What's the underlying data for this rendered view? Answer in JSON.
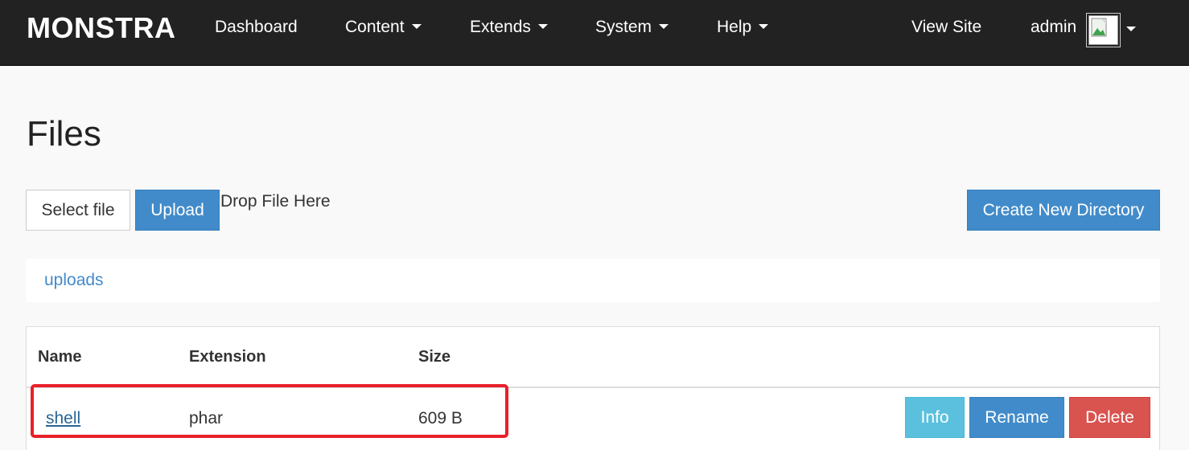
{
  "navbar": {
    "brand": "MONSTRA",
    "items": [
      {
        "label": "Dashboard"
      },
      {
        "label": "Content"
      },
      {
        "label": "Extends"
      },
      {
        "label": "System"
      },
      {
        "label": "Help"
      }
    ],
    "view_site": "View Site",
    "user": "admin"
  },
  "page": {
    "title": "Files"
  },
  "upload": {
    "select_file": "Select file",
    "upload": "Upload",
    "drop_text": "Drop File Here",
    "create_dir": "Create New Directory"
  },
  "breadcrumb": {
    "path": "uploads"
  },
  "table": {
    "headers": {
      "name": "Name",
      "extension": "Extension",
      "size": "Size"
    },
    "rows": [
      {
        "name": "shell",
        "extension": "phar",
        "size": "609 B",
        "actions": {
          "info": "Info",
          "rename": "Rename",
          "delete": "Delete"
        }
      }
    ]
  },
  "colors": {
    "navbar_bg": "#222222",
    "primary": "#428bca",
    "info": "#5bc0de",
    "danger": "#d9534f",
    "highlight": "#e8202a"
  }
}
